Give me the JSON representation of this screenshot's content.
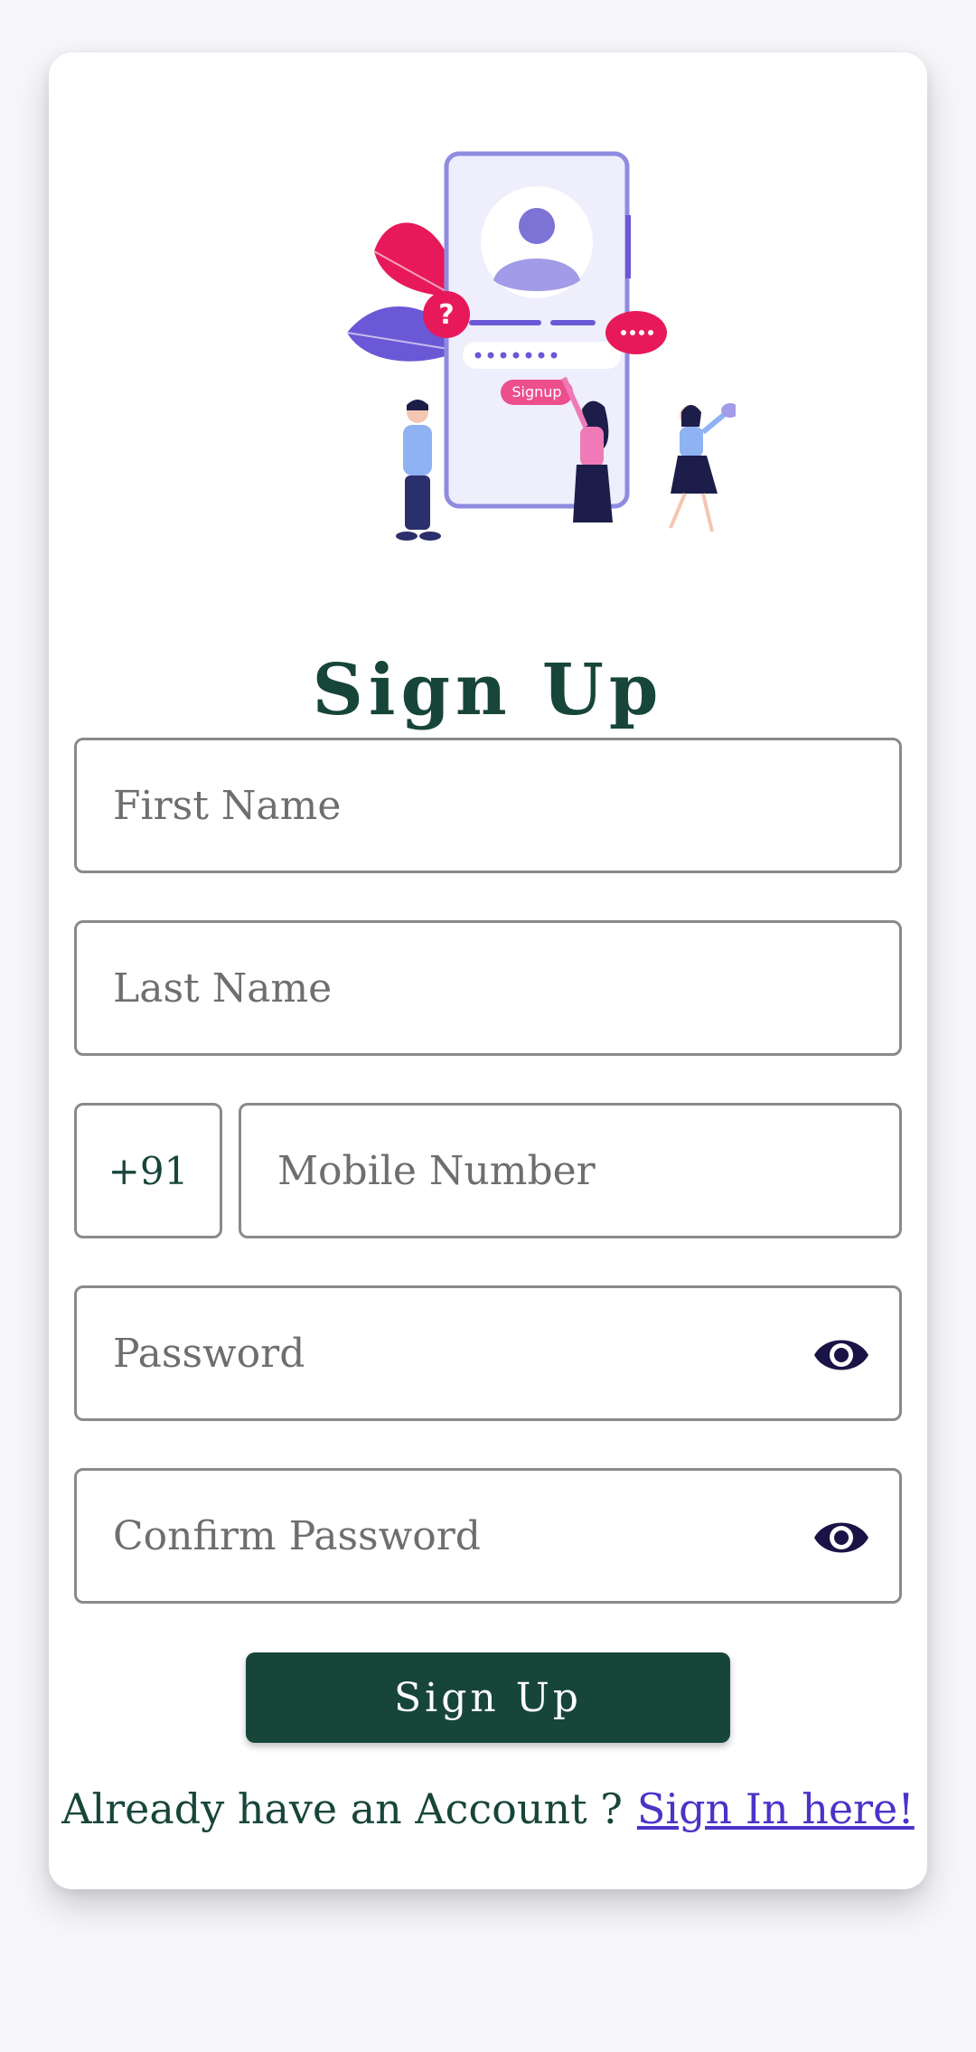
{
  "illustration": {
    "badge_text": "Signup"
  },
  "form": {
    "title": "Sign Up",
    "first_name_placeholder": "First Name",
    "last_name_placeholder": "Last Name",
    "country_code": "+91",
    "mobile_placeholder": "Mobile Number",
    "password_placeholder": "Password",
    "confirm_password_placeholder": "Confirm Password",
    "submit_label": "Sign Up"
  },
  "footer": {
    "prompt": "Already have an Account ?",
    "link_label": "Sign In here!"
  },
  "icons": {
    "password_toggle": "eye-icon"
  },
  "colors": {
    "primary": "#17453a",
    "link": "#4b33c8",
    "eye": "#1a1446",
    "accent_pink": "#e8195a",
    "accent_purple": "#6b58d6"
  }
}
